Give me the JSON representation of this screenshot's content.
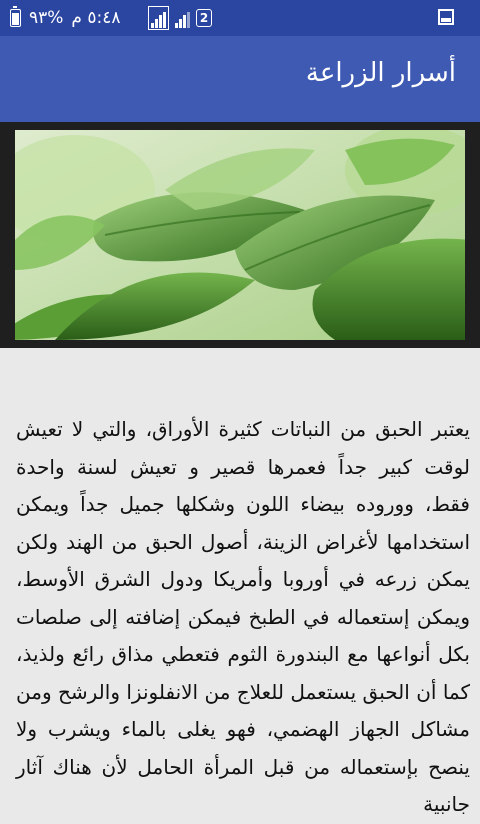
{
  "status_bar": {
    "time": "٥:٤٨ م",
    "battery_percent": "%٩٣",
    "sim_badge": "2"
  },
  "app_bar": {
    "title": "أسرار الزراعة"
  },
  "hero": {
    "subject": "basil-leaves",
    "colors": {
      "bg": "#cfe2b8",
      "leaf_dark": "#2f6b1c",
      "leaf_mid": "#4f9a2e",
      "leaf_light": "#8cc56a"
    }
  },
  "article": {
    "body": "يعتبر الحبق من النباتات كثيرة الأوراق، والتي لا تعيش لوقت كبير جداً فعمرها قصير و تعيش لسنة واحدة فقط، ووروده بيضاء اللون وشكلها جميل جداً ويمكن استخدامها لأغراض الزينة، أصول الحبق من الهند ولكن يمكن زرعه في أوروبا وأمريكا ودول الشرق الأوسط، ويمكن إستعماله في الطبخ فيمكن إضافته إلى صلصات بكل أنواعها مع البندورة الثوم فتعطي مذاق رائع ولذيذ، كما أن الحبق يستعمل للعلاج من الانفلونزا والرشح ومن مشاكل الجهاز الهضمي، فهو يغلى بالماء ويشرب ولا ينصح بإستعماله من قبل المرأة الحامل لأن هناك آثار جانبية"
  },
  "colors": {
    "status_bar": "#2b46a1",
    "app_bar": "#3f5ab3",
    "page_bg": "#e9e9e9"
  }
}
